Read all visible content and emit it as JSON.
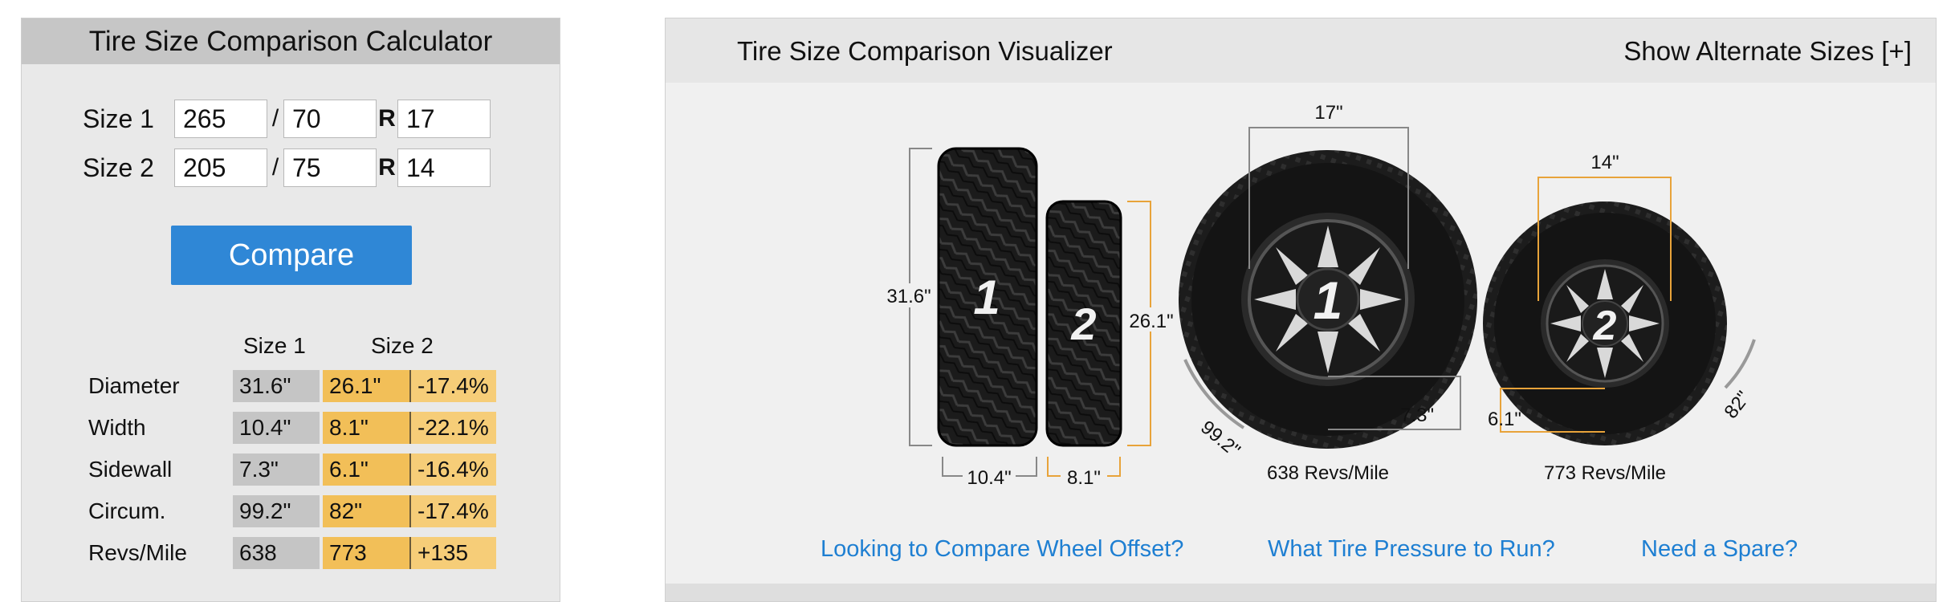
{
  "calculator": {
    "title": "Tire Size Comparison Calculator",
    "size1": {
      "label": "Size 1",
      "width": "265",
      "aspect": "70",
      "rim": "17"
    },
    "size2": {
      "label": "Size 2",
      "width": "205",
      "aspect": "75",
      "rim": "14"
    },
    "slash": "/",
    "r_label": "R",
    "compare_button": "Compare",
    "results": {
      "col_size1": "Size 1",
      "col_size2": "Size 2",
      "rows": [
        {
          "label": "Diameter",
          "size1": "31.6\"",
          "size2": "26.1\"",
          "diff": "-17.4%"
        },
        {
          "label": "Width",
          "size1": "10.4\"",
          "size2": "8.1\"",
          "diff": "-22.1%"
        },
        {
          "label": "Sidewall",
          "size1": "7.3\"",
          "size2": "6.1\"",
          "diff": "-16.4%"
        },
        {
          "label": "Circum.",
          "size1": "99.2\"",
          "size2": "82\"",
          "diff": "-17.4%"
        },
        {
          "label": "Revs/Mile",
          "size1": "638",
          "size2": "773",
          "diff": "+135"
        }
      ]
    }
  },
  "visualizer": {
    "title": "Tire Size Comparison Visualizer",
    "toggle": "Show Alternate Sizes [+]",
    "side_view": {
      "tire1_number": "1",
      "tire2_number": "2",
      "tire1_diameter": "31.6\"",
      "tire2_diameter": "26.1\"",
      "tire1_width": "10.4\"",
      "tire2_width": "8.1\""
    },
    "front_view": {
      "tire1_rim": "17\"",
      "tire2_rim": "14\"",
      "tire1_sidewall": "7.3\"",
      "tire2_sidewall": "6.1\"",
      "tire1_circum": "99.2\"",
      "tire2_circum": "82\"",
      "tire1_revs": "638 Revs/Mile",
      "tire2_revs": "773 Revs/Mile"
    },
    "links": {
      "offset": "Looking to Compare Wheel Offset?",
      "pressure": "What Tire Pressure to Run?",
      "spare": "Need a Spare?"
    }
  },
  "colors": {
    "accent_blue": "#2f87d6",
    "link_blue": "#1e7fd2",
    "size2_orange": "#f2bf58",
    "size2_guide": "#e8a33a",
    "size1_gray": "#c5c5c5"
  }
}
